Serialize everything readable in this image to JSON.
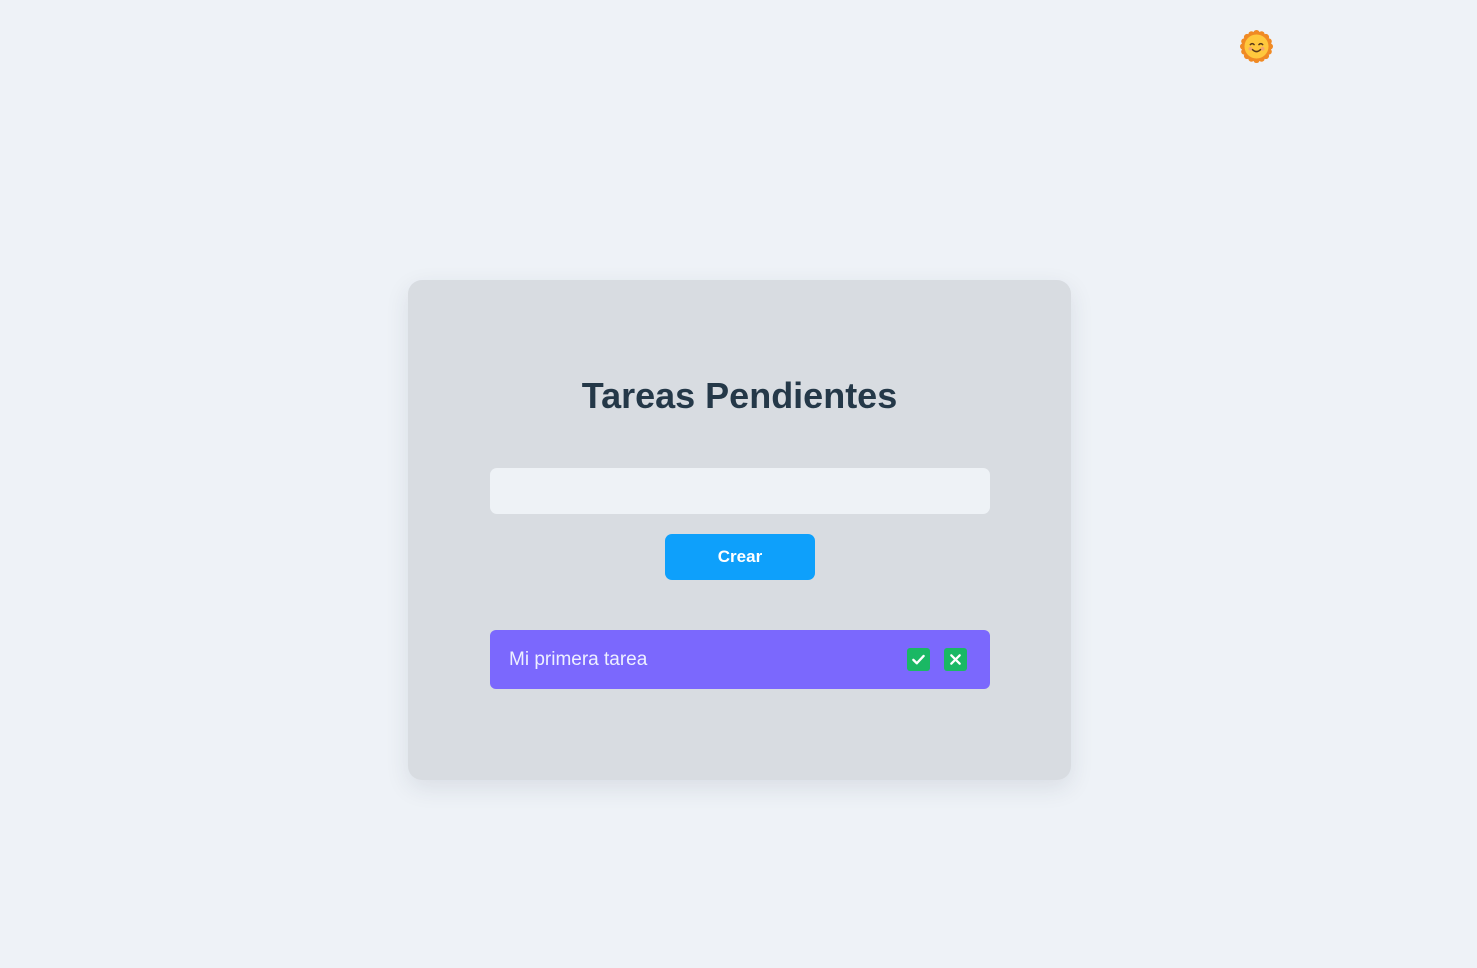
{
  "page": {
    "title": "Tareas Pendientes"
  },
  "theme_toggle": {
    "icon": "sun-smile-icon"
  },
  "form": {
    "input_value": "",
    "create_label": "Crear"
  },
  "tasks": [
    {
      "text": "Mi primera tarea",
      "complete_icon": "check-icon",
      "delete_icon": "close-icon"
    }
  ],
  "colors": {
    "background": "#eef2f7",
    "card": "#d8dce1",
    "title": "#243848",
    "primary_button": "#0ea0fb",
    "task_item": "#7b68fd",
    "task_action": "#1ab864"
  }
}
